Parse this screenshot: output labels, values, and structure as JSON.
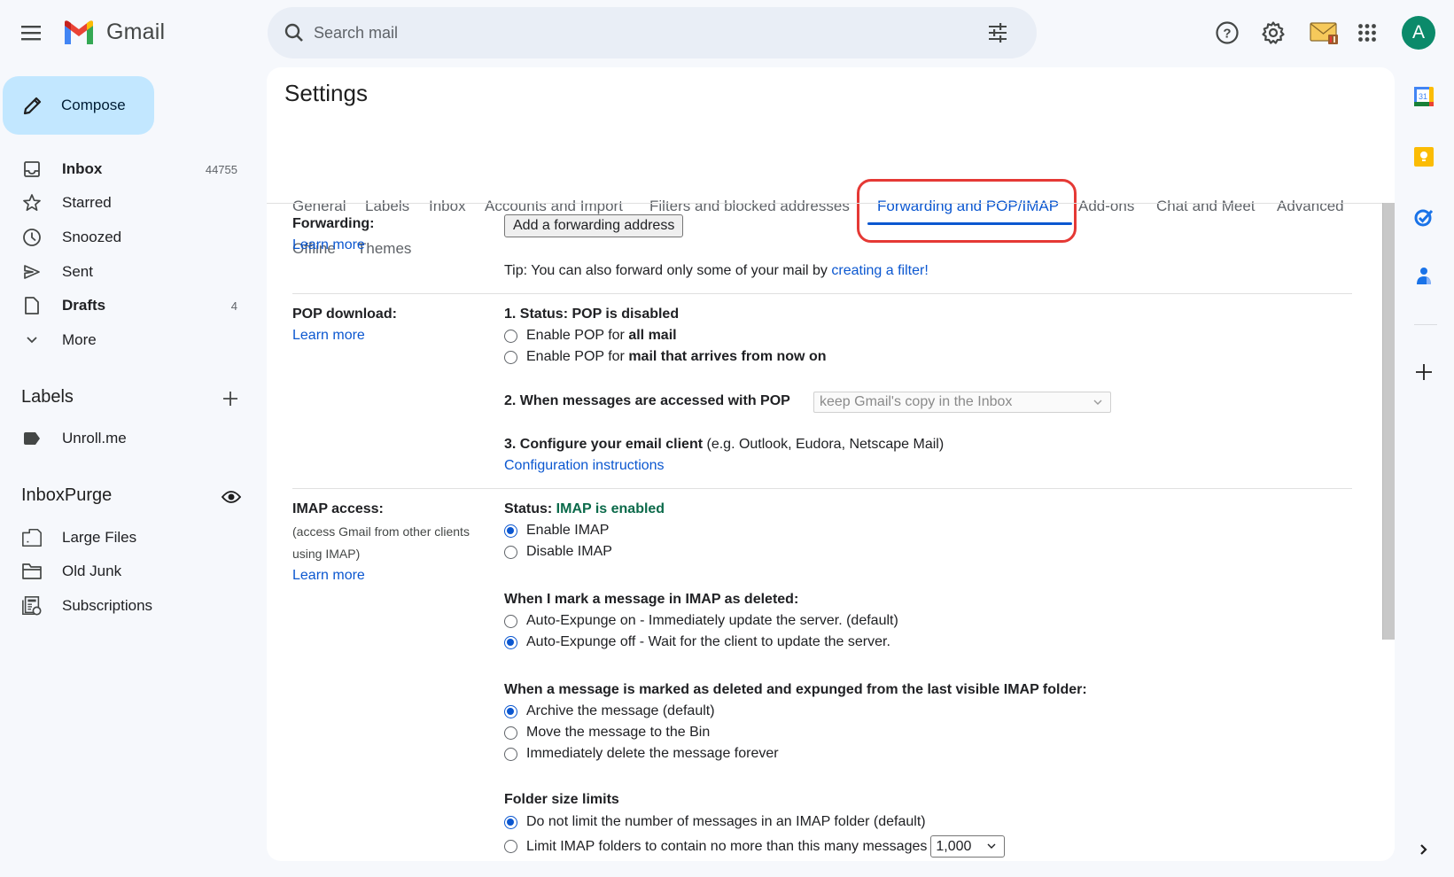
{
  "app": {
    "name": "Gmail"
  },
  "search": {
    "placeholder": "Search mail"
  },
  "header_icons": [
    "help-icon",
    "settings-icon",
    "inboxpurge-mail-icon",
    "apps-grid-icon"
  ],
  "account": {
    "initial": "A",
    "color": "#0b8a6a"
  },
  "compose": {
    "label": "Compose"
  },
  "nav": [
    {
      "label": "Inbox",
      "count": "44755",
      "icon": "inbox-icon",
      "bold": true
    },
    {
      "label": "Starred",
      "count": "",
      "icon": "star-icon",
      "bold": false
    },
    {
      "label": "Snoozed",
      "count": "",
      "icon": "clock-icon",
      "bold": false
    },
    {
      "label": "Sent",
      "count": "",
      "icon": "send-icon",
      "bold": false
    },
    {
      "label": "Drafts",
      "count": "4",
      "icon": "draft-icon",
      "bold": true
    },
    {
      "label": "More",
      "count": "",
      "icon": "chevron-down-icon",
      "bold": false
    }
  ],
  "labels": {
    "title": "Labels",
    "items": [
      {
        "label": "Unroll.me"
      }
    ]
  },
  "inboxpurge": {
    "title": "InboxPurge",
    "items": [
      {
        "label": "Large Files"
      },
      {
        "label": "Old Junk"
      },
      {
        "label": "Subscriptions"
      }
    ]
  },
  "settings": {
    "title": "Settings",
    "tabs": [
      {
        "label": "General"
      },
      {
        "label": "Labels"
      },
      {
        "label": "Inbox"
      },
      {
        "label": "Accounts and Import"
      },
      {
        "label": "Filters and blocked addresses"
      },
      {
        "label": "Forwarding and POP/IMAP",
        "active": true
      },
      {
        "label": "Add-ons"
      },
      {
        "label": "Chat and Meet"
      },
      {
        "label": "Advanced"
      },
      {
        "label": "Offline"
      },
      {
        "label": "Themes"
      }
    ],
    "highlight_color": "#e53935",
    "accent_color": "#0b57d0",
    "forwarding": {
      "label": "Forwarding:",
      "learn_more": "Learn more",
      "button": "Add a forwarding address",
      "tip_prefix": "Tip: You can also forward only some of your mail by ",
      "tip_link": "creating a filter!"
    },
    "pop": {
      "label": "POP download:",
      "learn_more": "Learn more",
      "status": "1. Status: POP is disabled",
      "options": [
        {
          "prefix": "Enable POP for ",
          "bold": "all mail",
          "selected": false
        },
        {
          "prefix": "Enable POP for ",
          "bold": "mail that arrives from now on",
          "selected": false
        }
      ],
      "step2_label": "2. When messages are accessed with POP",
      "step2_value": "keep Gmail's copy in the Inbox",
      "step3_label": "3. Configure your email client",
      "step3_note": " (e.g. Outlook, Eudora, Netscape Mail)",
      "config_link": "Configuration instructions"
    },
    "imap": {
      "label": "IMAP access:",
      "sublabel_1": "(access Gmail from other clients",
      "sublabel_2": "using IMAP)",
      "learn_more": "Learn more",
      "status_prefix": "Status: ",
      "status_value": "IMAP is enabled",
      "access_options": [
        {
          "label": "Enable IMAP",
          "selected": true
        },
        {
          "label": "Disable IMAP",
          "selected": false
        }
      ],
      "deleted_heading": "When I mark a message in IMAP as deleted:",
      "deleted_options": [
        {
          "label": "Auto-Expunge on - Immediately update the server. (default)",
          "selected": false
        },
        {
          "label": "Auto-Expunge off - Wait for the client to update the server.",
          "selected": true
        }
      ],
      "expunged_heading": "When a message is marked as deleted and expunged from the last visible IMAP folder:",
      "expunged_options": [
        {
          "label": "Archive the message (default)",
          "selected": true
        },
        {
          "label": "Move the message to the Bin",
          "selected": false
        },
        {
          "label": "Immediately delete the message forever",
          "selected": false
        }
      ],
      "folder_heading": "Folder size limits",
      "folder_options": [
        {
          "label": "Do not limit the number of messages in an IMAP folder (default)",
          "selected": true
        },
        {
          "label": "Limit IMAP folders to contain no more than this many messages",
          "selected": false
        }
      ],
      "folder_limit_value": "1,000"
    }
  },
  "side_panel": [
    "calendar-icon",
    "keep-icon",
    "tasks-icon",
    "contacts-icon",
    "add-addon-icon"
  ]
}
